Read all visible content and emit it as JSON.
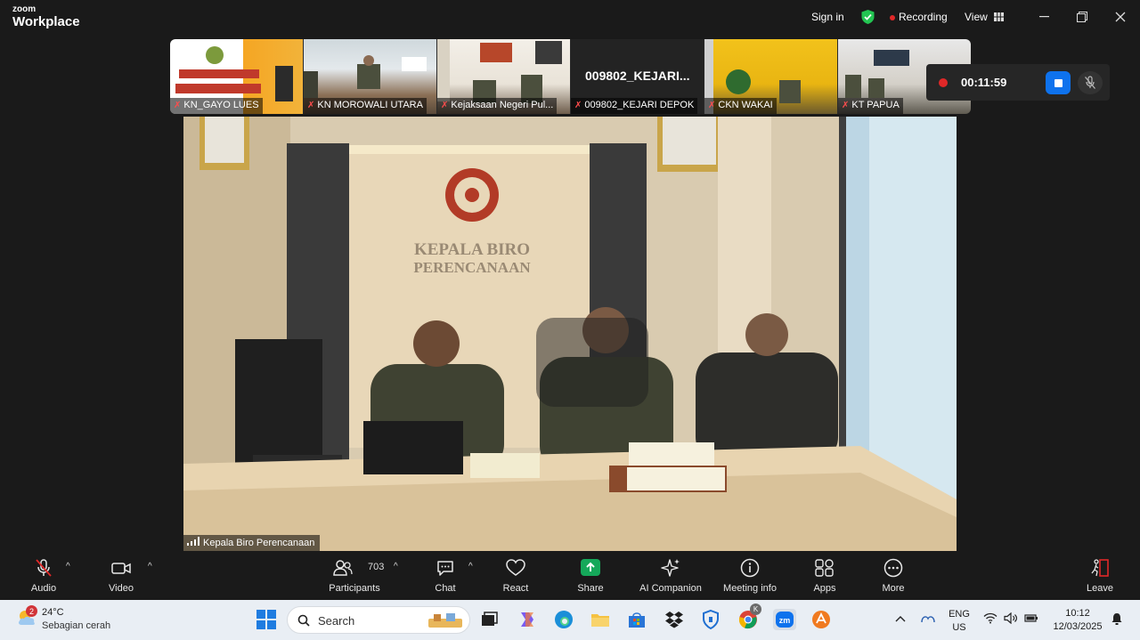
{
  "app": {
    "logo_small": "zoom",
    "logo_big": "Workplace",
    "sign_in": "Sign in",
    "recording": "Recording",
    "view": "View"
  },
  "filmstrip": [
    {
      "name": "KN_GAYO LUES",
      "muted": true
    },
    {
      "name": "KN MOROWALI UTARA",
      "muted": true
    },
    {
      "name": "Kejaksaan Negeri Pul...",
      "muted": true
    },
    {
      "name": "009802_KEJARI DEPOK",
      "muted": true,
      "display_name": "009802_KEJARI..."
    },
    {
      "name": "CKN  WAKAI",
      "muted": true
    },
    {
      "name": "KT PAPUA",
      "muted": true
    }
  ],
  "recording_widget": {
    "timer": "00:11:59"
  },
  "main_video": {
    "speaker": "Kepala Biro Perencanaan",
    "sign_line1": "KEPALA BIRO",
    "sign_line2": "PERENCANAAN"
  },
  "toolbar": {
    "audio": "Audio",
    "video": "Video",
    "participants": "Participants",
    "participants_count": "703",
    "chat": "Chat",
    "react": "React",
    "share": "Share",
    "ai_companion": "AI Companion",
    "meeting_info": "Meeting info",
    "apps": "Apps",
    "more": "More",
    "leave": "Leave"
  },
  "taskbar": {
    "weather_badge": "2",
    "temperature": "24°C",
    "condition": "Sebagian cerah",
    "search_placeholder": "Search",
    "chrome_badge": "K",
    "lang_top": "ENG",
    "lang_bottom": "US",
    "time": "10:12",
    "date": "12/03/2025"
  },
  "colors": {
    "zoom_blue": "#0e72ed",
    "record_red": "#e02828",
    "share_green": "#15a85a",
    "leave_red": "#e02828"
  }
}
